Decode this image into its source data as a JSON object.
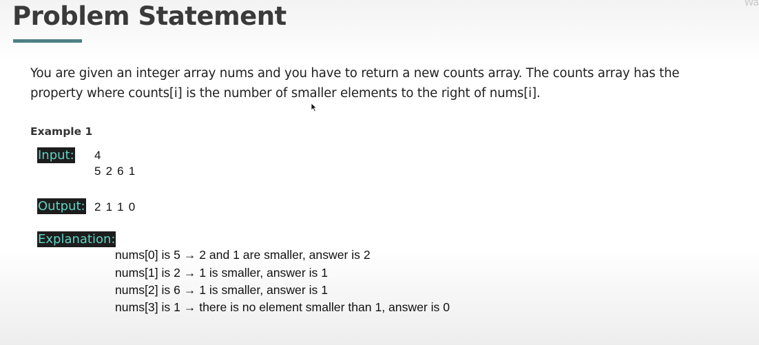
{
  "slide": {
    "title": "Problem Statement",
    "corner_text": "Wa"
  },
  "problem": {
    "line1": "You are given an integer array nums and you have to return a new counts array. The counts array has the",
    "line2": "property where counts[i] is the number of smaller elements to the right of nums[i]."
  },
  "example": {
    "heading": "Example 1",
    "input_label": "Input:",
    "input_values": [
      "4",
      "5 2 6 1"
    ],
    "output_label": "Output:",
    "output_value": "2 1 1 0",
    "explanation_label": "Explanation:",
    "explanation_lines": [
      "nums[0] is 5 → 2 and 1 are smaller, answer is 2",
      "nums[1] is 2 → 1 is smaller, answer is 1",
      "nums[2] is 6 → 1 is smaller, answer is 1",
      "nums[3] is 1 → there is no element smaller than 1, answer is 0"
    ]
  },
  "colors": {
    "underline_accent": "#4d7f86",
    "label_text": "#5fd3c4",
    "label_background": "#1d1d1d"
  },
  "icons": {
    "cursor": "mouse-pointer-icon"
  }
}
